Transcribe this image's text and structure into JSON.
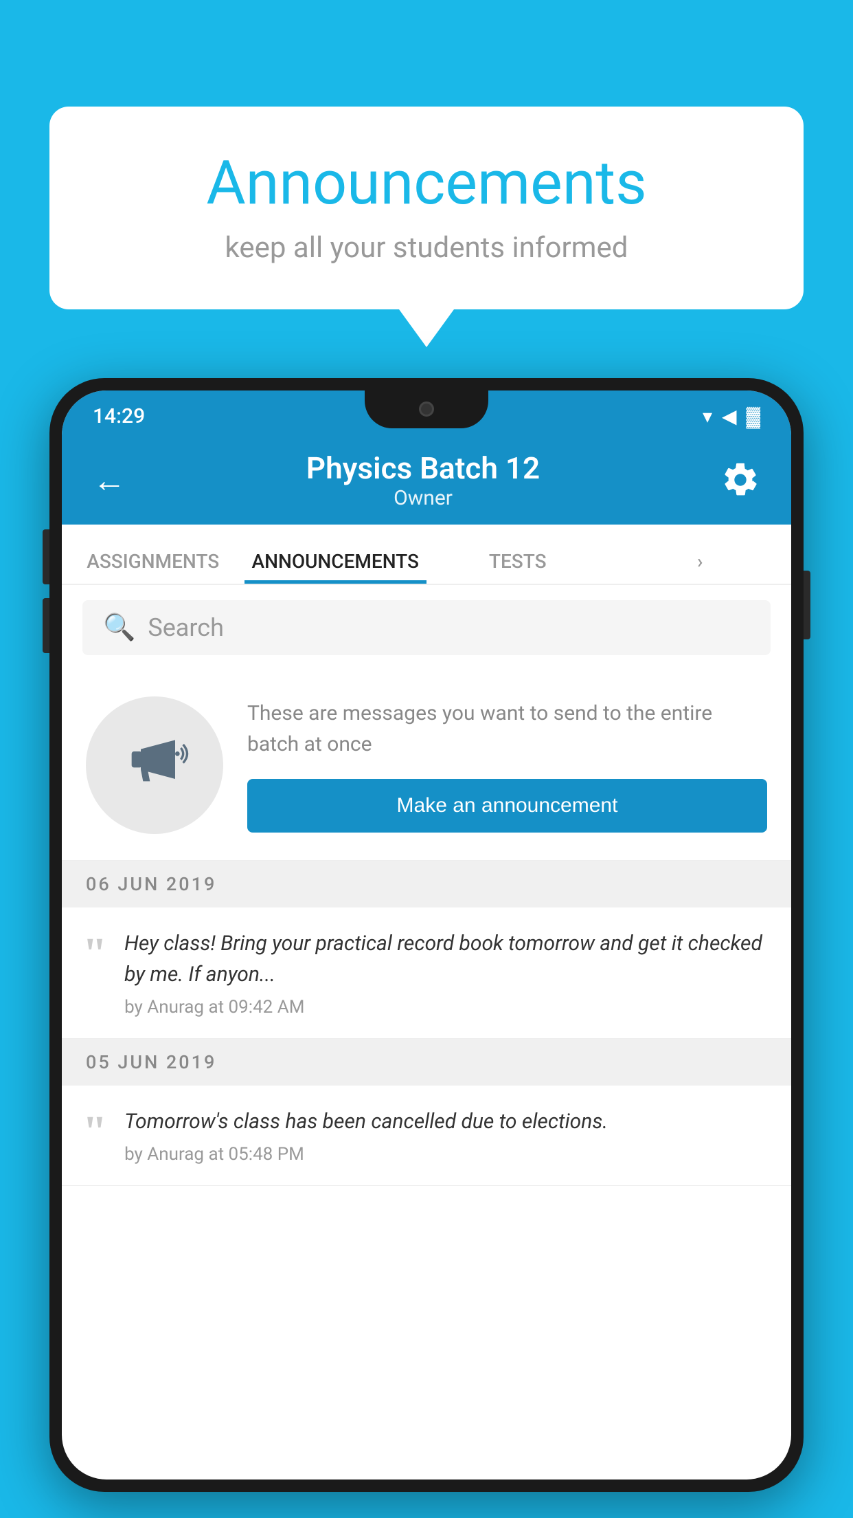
{
  "background_color": "#1ab8e8",
  "speech_bubble": {
    "title": "Announcements",
    "subtitle": "keep all your students informed"
  },
  "phone": {
    "status_bar": {
      "time": "14:29",
      "wifi": "▾",
      "signal": "▾",
      "battery": "▓"
    },
    "header": {
      "title": "Physics Batch 12",
      "subtitle": "Owner",
      "back_label": "←",
      "settings_label": "⚙"
    },
    "tabs": [
      {
        "label": "ASSIGNMENTS",
        "active": false
      },
      {
        "label": "ANNOUNCEMENTS",
        "active": true
      },
      {
        "label": "TESTS",
        "active": false
      },
      {
        "label": "•",
        "active": false
      }
    ],
    "search": {
      "placeholder": "Search"
    },
    "announcement_prompt": {
      "description": "These are messages you want to send to the entire batch at once",
      "button_label": "Make an announcement"
    },
    "messages": [
      {
        "date": "06  JUN  2019",
        "text": "Hey class! Bring your practical record book tomorrow and get it checked by me. If anyon...",
        "author": "by Anurag at 09:42 AM"
      },
      {
        "date": "05  JUN  2019",
        "text": "Tomorrow's class has been cancelled due to elections.",
        "author": "by Anurag at 05:48 PM"
      }
    ]
  }
}
